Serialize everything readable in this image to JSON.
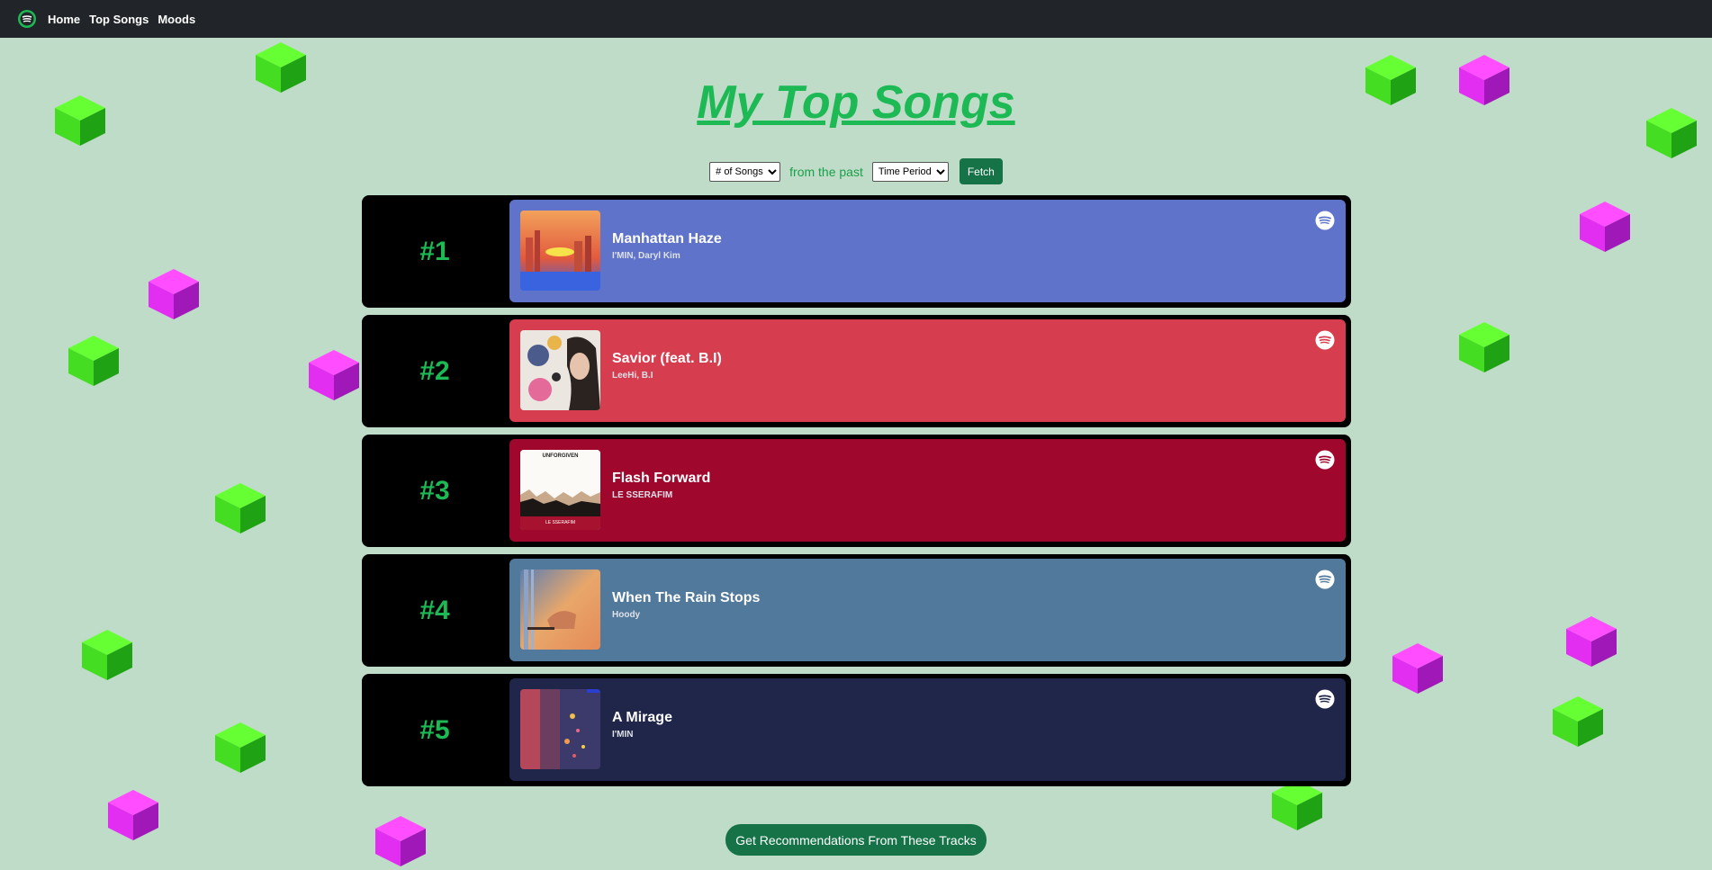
{
  "nav": {
    "logo_icon": "spotify-logo-icon",
    "links": [
      "Home",
      "Top Songs",
      "Moods"
    ]
  },
  "page": {
    "title": "My Top Songs"
  },
  "controls": {
    "count_select": "# of Songs",
    "past_label": "from the past",
    "period_select": "Time Period",
    "fetch_label": "Fetch"
  },
  "tracks": [
    {
      "rank": "#1",
      "title": "Manhattan Haze",
      "artists": "I'MIN, Daryl Kim",
      "color": "#5e73c9"
    },
    {
      "rank": "#2",
      "title": "Savior (feat. B.I)",
      "artists": "LeeHi, B.I",
      "color": "#d63d4e"
    },
    {
      "rank": "#3",
      "title": "Flash Forward",
      "artists": "LE SSERAFIM",
      "color": "#a0072d"
    },
    {
      "rank": "#4",
      "title": "When The Rain Stops",
      "artists": "Hoody",
      "color": "#51799b"
    },
    {
      "rank": "#5",
      "title": "A Mirage",
      "artists": "I'MIN",
      "color": "#1f264a"
    }
  ],
  "album_art_text": {
    "track3_top": "UNFORGIVEN",
    "track3_bottom": "LE SSERAFIM"
  },
  "recommend_label": "Get Recommendations From These Tracks",
  "colors": {
    "background": "#bfdcc8",
    "accent": "#1db954",
    "button": "#157347",
    "cube_green": "#2ecc1f",
    "cube_magenta": "#d21fe8"
  }
}
